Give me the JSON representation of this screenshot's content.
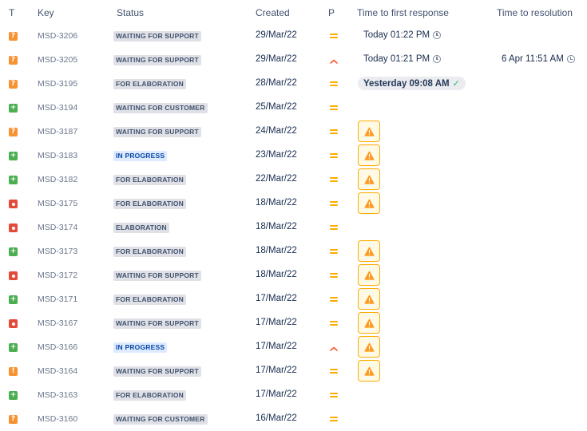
{
  "columns": {
    "type": "T",
    "key": "Key",
    "status": "Status",
    "created": "Created",
    "priority": "P",
    "time_to_first_response": "Time to first response",
    "time_to_resolution": "Time to resolution"
  },
  "colors": {
    "question_icon": "#f79232",
    "task_icon": "#4bae4f",
    "bug_icon": "#e5493a",
    "priority_medium": "#ffab00",
    "priority_high": "#ff5630",
    "sla_breached_border": "#ffab00",
    "status_blue_text": "#0747a6"
  },
  "rows": [
    {
      "type": "question",
      "type_icon": "question-icon",
      "key": "MSD-3206",
      "status": "WAITING FOR SUPPORT",
      "created": "29/Mar/22",
      "priority": "medium",
      "ttfr": "Today 01:22 PM",
      "ttfr_state": "ongoing",
      "ttr": ""
    },
    {
      "type": "question",
      "type_icon": "question-icon",
      "key": "MSD-3205",
      "status": "WAITING FOR SUPPORT",
      "created": "29/Mar/22",
      "priority": "high",
      "ttfr": "Today 01:21 PM",
      "ttfr_state": "ongoing",
      "ttr": "6 Apr 11:51 AM"
    },
    {
      "type": "question",
      "type_icon": "question-icon",
      "key": "MSD-3195",
      "status": "FOR ELABORATION",
      "created": "28/Mar/22",
      "priority": "medium",
      "ttfr": "Yesterday 09:08 AM",
      "ttfr_state": "met",
      "ttr": ""
    },
    {
      "type": "task",
      "type_icon": "plus-icon",
      "key": "MSD-3194",
      "status": "WAITING FOR CUSTOMER",
      "created": "25/Mar/22",
      "priority": "medium",
      "ttfr": "",
      "ttfr_state": "none",
      "ttr": ""
    },
    {
      "type": "question",
      "type_icon": "question-icon",
      "key": "MSD-3187",
      "status": "WAITING FOR SUPPORT",
      "created": "24/Mar/22",
      "priority": "medium",
      "ttfr": "",
      "ttfr_state": "breached",
      "ttr": ""
    },
    {
      "type": "task",
      "type_icon": "plus-icon",
      "key": "MSD-3183",
      "status": "IN PROGRESS",
      "created": "23/Mar/22",
      "priority": "medium",
      "ttfr": "",
      "ttfr_state": "breached",
      "ttr": ""
    },
    {
      "type": "task",
      "type_icon": "plus-icon",
      "key": "MSD-3182",
      "status": "FOR ELABORATION",
      "created": "22/Mar/22",
      "priority": "medium",
      "ttfr": "",
      "ttfr_state": "breached",
      "ttr": ""
    },
    {
      "type": "bug",
      "type_icon": "bug-dot-icon",
      "key": "MSD-3175",
      "status": "FOR ELABORATION",
      "created": "18/Mar/22",
      "priority": "medium",
      "ttfr": "",
      "ttfr_state": "breached",
      "ttr": ""
    },
    {
      "type": "bug",
      "type_icon": "bug-dot-icon",
      "key": "MSD-3174",
      "status": "ELABORATION",
      "created": "18/Mar/22",
      "priority": "medium",
      "ttfr": "",
      "ttfr_state": "none",
      "ttr": ""
    },
    {
      "type": "task",
      "type_icon": "plus-icon",
      "key": "MSD-3173",
      "status": "FOR ELABORATION",
      "created": "18/Mar/22",
      "priority": "medium",
      "ttfr": "",
      "ttfr_state": "breached",
      "ttr": ""
    },
    {
      "type": "bug",
      "type_icon": "bug-dot-icon",
      "key": "MSD-3172",
      "status": "WAITING FOR SUPPORT",
      "created": "18/Mar/22",
      "priority": "medium",
      "ttfr": "",
      "ttfr_state": "breached",
      "ttr": ""
    },
    {
      "type": "task",
      "type_icon": "plus-icon",
      "key": "MSD-3171",
      "status": "FOR ELABORATION",
      "created": "17/Mar/22",
      "priority": "medium",
      "ttfr": "",
      "ttfr_state": "breached",
      "ttr": ""
    },
    {
      "type": "bug",
      "type_icon": "bug-dot-icon",
      "key": "MSD-3167",
      "status": "WAITING FOR SUPPORT",
      "created": "17/Mar/22",
      "priority": "medium",
      "ttfr": "",
      "ttfr_state": "breached",
      "ttr": ""
    },
    {
      "type": "task",
      "type_icon": "plus-icon",
      "key": "MSD-3166",
      "status": "IN PROGRESS",
      "created": "17/Mar/22",
      "priority": "high",
      "ttfr": "",
      "ttfr_state": "breached",
      "ttr": ""
    },
    {
      "type": "warning",
      "type_icon": "exclamation-icon",
      "key": "MSD-3164",
      "status": "WAITING FOR SUPPORT",
      "created": "17/Mar/22",
      "priority": "medium",
      "ttfr": "",
      "ttfr_state": "breached",
      "ttr": ""
    },
    {
      "type": "task",
      "type_icon": "plus-icon",
      "key": "MSD-3163",
      "status": "FOR ELABORATION",
      "created": "17/Mar/22",
      "priority": "medium",
      "ttfr": "",
      "ttfr_state": "none",
      "ttr": ""
    },
    {
      "type": "question",
      "type_icon": "question-icon",
      "key": "MSD-3160",
      "status": "WAITING FOR CUSTOMER",
      "created": "16/Mar/22",
      "priority": "medium",
      "ttfr": "",
      "ttfr_state": "none",
      "ttr": ""
    }
  ]
}
